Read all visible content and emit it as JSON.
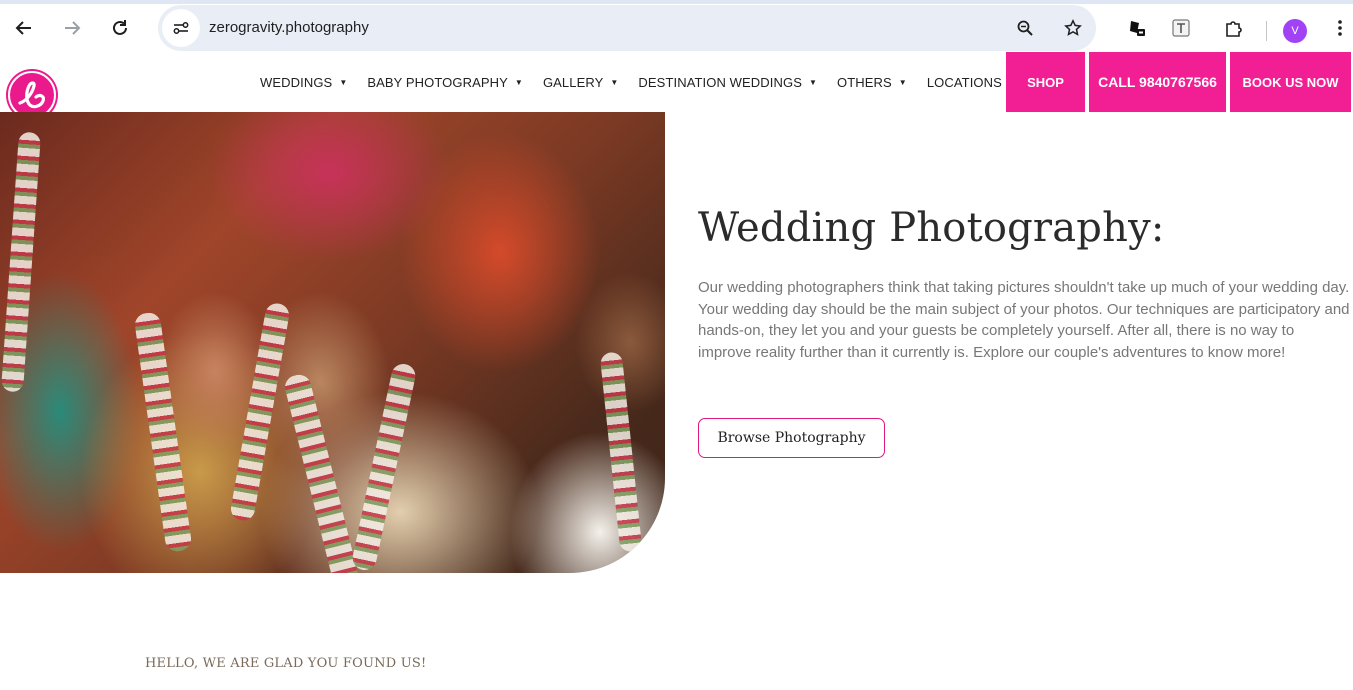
{
  "browser": {
    "url": "zerogravity.photography",
    "profile_initial": "V",
    "icons": [
      "back-arrow-icon",
      "forward-arrow-icon",
      "reload-icon",
      "site-info-icon",
      "zoom-icon",
      "bookmark-star-icon",
      "extension-puzzle-icon",
      "menu-dots-icon"
    ]
  },
  "header": {
    "nav": [
      {
        "label": "WEDDINGS"
      },
      {
        "label": "BABY PHOTOGRAPHY"
      },
      {
        "label": "GALLERY"
      },
      {
        "label": "DESTINATION WEDDINGS"
      },
      {
        "label": "OTHERS"
      },
      {
        "label": "LOCATIONS"
      }
    ],
    "shop_label": "SHOP",
    "call_label": "CALL 9840767566",
    "book_label": "BOOK US NOW",
    "accent_color": "#f21f94"
  },
  "hero": {
    "title": "Wedding Photography:",
    "body": "Our wedding photographers think that taking pictures shouldn't take up much of your wedding day. Your wedding day should be the main subject of your photos. Our techniques are participatory and hands-on, they let you and your guests be completely yourself. After all, there is no way to improve reality further than it currently is. Explore our couple's adventures to know more!",
    "button_label": "Browse Photography"
  },
  "intro": {
    "tagline": "HELLO, WE ARE GLAD YOU FOUND US!"
  }
}
